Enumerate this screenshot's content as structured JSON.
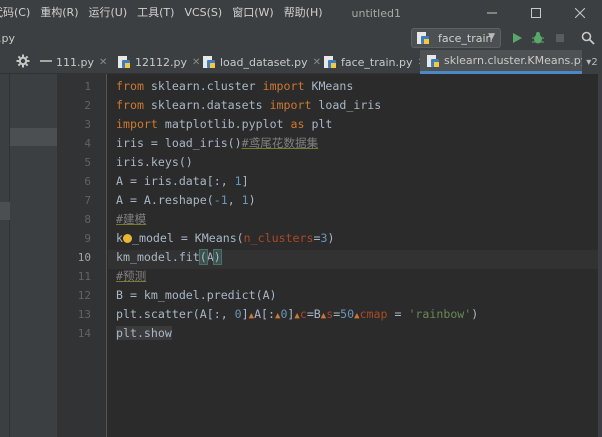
{
  "menu": [
    "代码(C)",
    "重构(R)",
    "运行(U)",
    "工具(T)",
    "VCS(S)",
    "窗口(W)",
    "帮助(H)"
  ],
  "window_title": "untitled1",
  "breadcrumb": {
    "file": ".py"
  },
  "run_config": {
    "name": "face_train"
  },
  "tabs": [
    {
      "label": "111.py",
      "active": false
    },
    {
      "label": "12112.py",
      "active": false
    },
    {
      "label": "load_dataset.py",
      "active": false
    },
    {
      "label": "face_train.py",
      "active": false
    },
    {
      "label": "sklearn.cluster.KMeans.py",
      "active": true
    }
  ],
  "tab_overflow": "2",
  "editor": {
    "current_line": 10,
    "lines": [
      {
        "n": "1"
      },
      {
        "n": "2"
      },
      {
        "n": "3"
      },
      {
        "n": "4"
      },
      {
        "n": "5"
      },
      {
        "n": "6"
      },
      {
        "n": "7"
      },
      {
        "n": "8"
      },
      {
        "n": "9"
      },
      {
        "n": "10"
      },
      {
        "n": "11"
      },
      {
        "n": "12"
      },
      {
        "n": "13"
      },
      {
        "n": "14"
      }
    ],
    "code": {
      "l1": {
        "kw1": "from",
        "mod": " sklearn.cluster ",
        "kw2": "import",
        "name": " KMeans"
      },
      "l2": {
        "kw1": "from",
        "mod": " sklearn.datasets ",
        "kw2": "import",
        "name": " load_iris"
      },
      "l3": {
        "kw1": "import",
        "mod": " matplotlib.pyplot ",
        "kw2": "as",
        "name": " plt"
      },
      "l4": {
        "code": "iris = load_iris()",
        "comment": "#鸢尾花数据集"
      },
      "l5": {
        "code": "iris.keys()"
      },
      "l6": {
        "pre": "A = iris.data[:, ",
        "num": "1",
        "post": "]"
      },
      "l7": {
        "pre": "A = A.reshape(",
        "num1": "-1",
        "mid": ", ",
        "num2": "1",
        "post": ")"
      },
      "l8": {
        "comment": "#建模"
      },
      "l9": {
        "pre": "k",
        "post": "_model = KMeans(",
        "param": "n_clusters",
        "eq": "=",
        "num": "3",
        "end": ")"
      },
      "l10": {
        "pre": "km_model.fit",
        "open": "(",
        "arg": "A",
        "close": ")"
      },
      "l11": {
        "comment": "#预测"
      },
      "l12": {
        "code": "B = km_model.predict(A)"
      },
      "l13": {
        "a": "plt.scatter(A[:, ",
        "n0": "0",
        "b": "]",
        "c": "A[:",
        "n1": "0",
        "d": "]",
        "p1": "c",
        "e": "=B",
        "p2": "s",
        "f": "=",
        "n50": "50",
        "p3": "cmap",
        "g": " = ",
        "s": "'rainbow'",
        "h": ")"
      },
      "l14": {
        "code": "plt.show"
      }
    }
  },
  "colors": {
    "accent": "#4a88c7",
    "keyword": "#cc7832",
    "string": "#6a8759",
    "number": "#6897bb",
    "comment": "#808080",
    "param": "#aa4926",
    "run": "#59a869"
  }
}
